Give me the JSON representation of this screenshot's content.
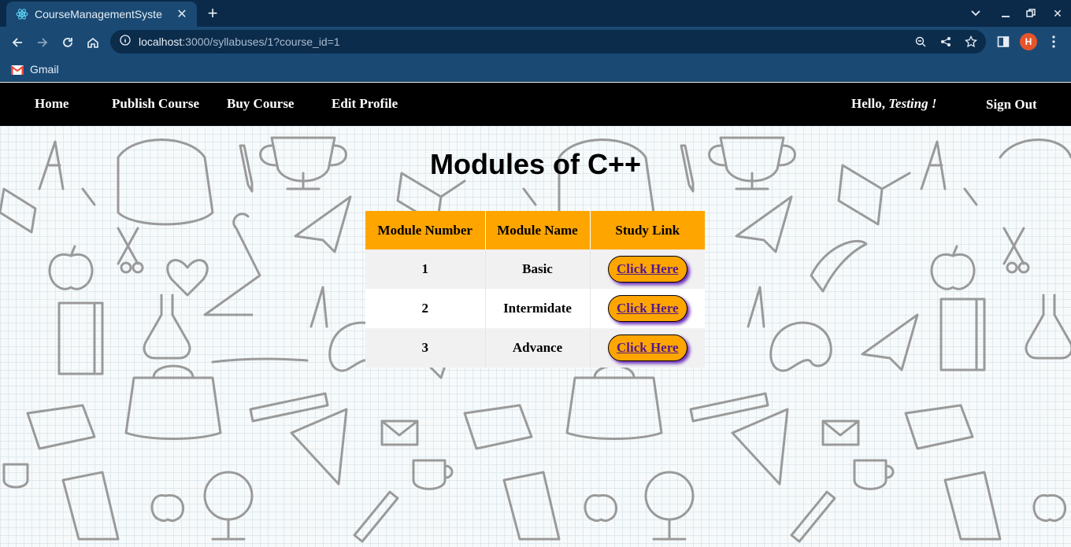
{
  "browser": {
    "tab_title": "CourseManagementSyste",
    "url_host": "localhost",
    "url_rest": ":3000/syllabuses/1?course_id=1",
    "avatar_letter": "H",
    "bookmark_label": "Gmail"
  },
  "nav": {
    "home": "Home",
    "publish": "Publish Course",
    "buy": "Buy Course",
    "edit": "Edit Profile",
    "hello_prefix": "Hello, ",
    "username": "Testing !",
    "signout": "Sign Out"
  },
  "page": {
    "title": "Modules of C++"
  },
  "table": {
    "headers": [
      "Module Number",
      "Module Name",
      "Study Link"
    ],
    "rows": [
      {
        "number": "1",
        "name": "Basic",
        "link": "Click Here"
      },
      {
        "number": "2",
        "name": "Intermidate",
        "link": "Click Here"
      },
      {
        "number": "3",
        "name": "Advance",
        "link": "Click Here"
      }
    ]
  },
  "colors": {
    "header_bg": "#ffa500",
    "nav_bg": "#000000",
    "chrome_bg": "#1a4a74",
    "link": "#551a8b"
  }
}
